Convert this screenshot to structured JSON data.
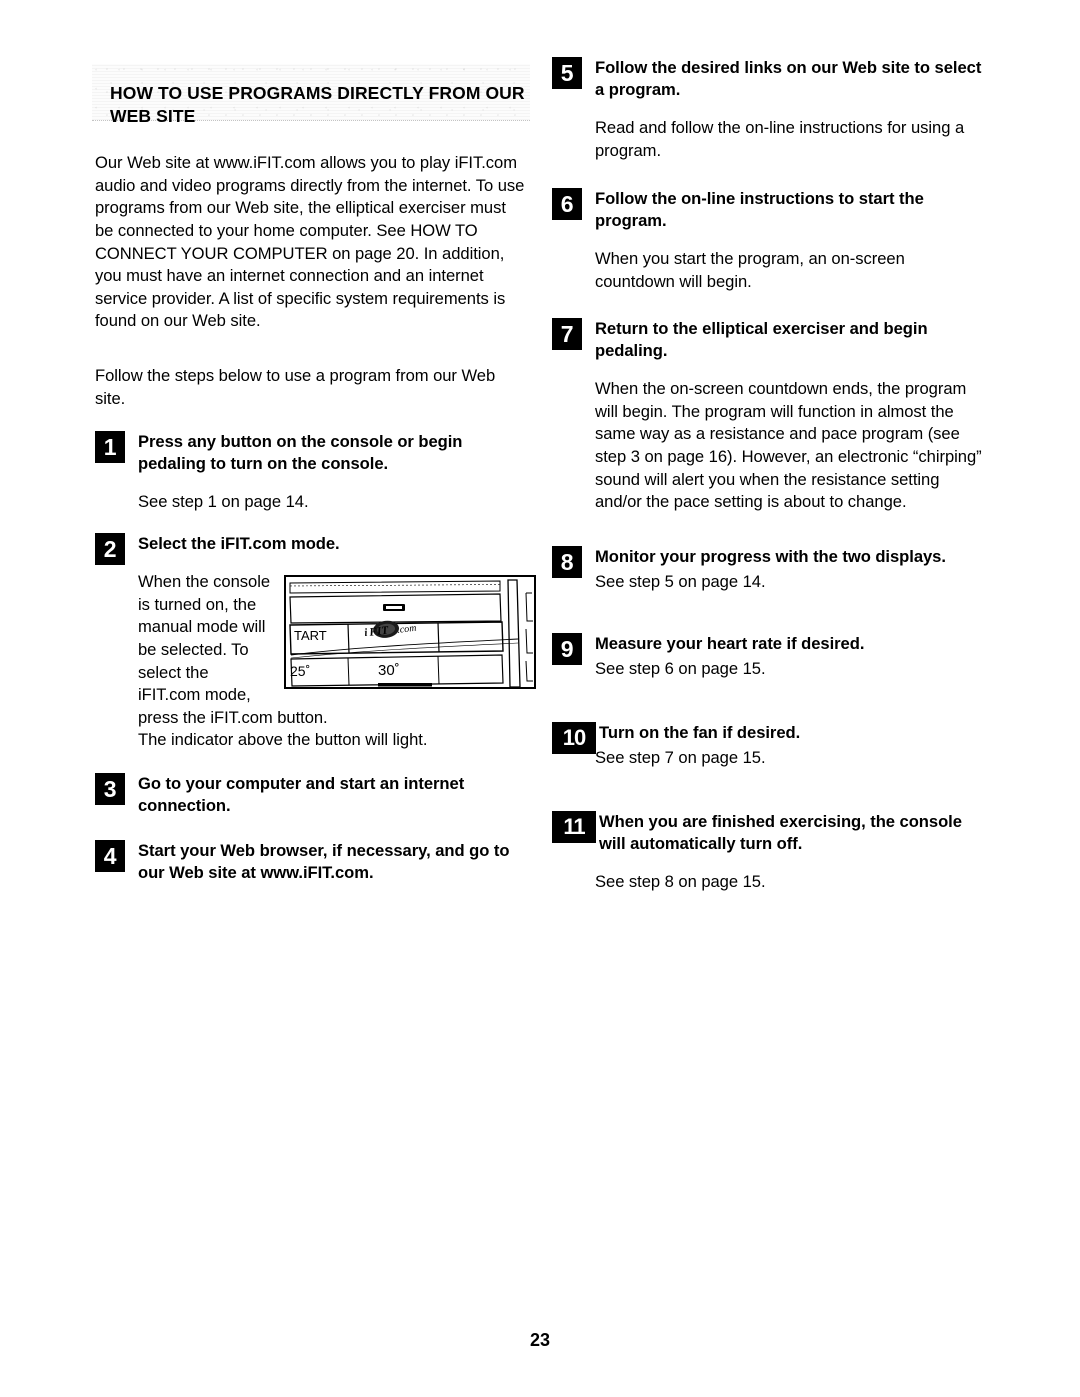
{
  "page": {
    "number": "23"
  },
  "section": {
    "heading": "HOW TO USE PROGRAMS DIRECTLY FROM OUR WEB SITE",
    "intro_paragraph": "Our Web site at www.iFIT.com allows you to play iFIT.com audio and video programs directly from the internet. To use programs from our Web site, the elliptical exerciser must be connected to your home computer. See HOW TO CONNECT YOUR COMPUTER on page 20. In addition, you must have an internet connection and an internet service provider. A list of specific system requirements is found on our Web site.",
    "follow_paragraph": "Follow the steps below to use a program from our Web site."
  },
  "steps": {
    "step1": {
      "number": "1",
      "title": "Press any button on the console or begin pedaling to turn on the console.",
      "body": "See step 1 on page 14."
    },
    "step2": {
      "number": "2",
      "title": "Select the iFIT.com mode.",
      "body_wrapped": "When the console is turned on, the manual mode will be selected. To select the iFIT.com mode, press the iFIT.com button.",
      "body_full": "The indicator above the button will light."
    },
    "step3": {
      "number": "3",
      "title": "Go to your computer and start an internet connection."
    },
    "step4": {
      "number": "4",
      "title": "Start your Web browser, if necessary, and go to our Web site at www.iFIT.com."
    },
    "step5": {
      "number": "5",
      "title": "Follow the desired links on our Web site to select a program.",
      "body": "Read and follow the on-line instructions for using a program."
    },
    "step6": {
      "number": "6",
      "title": "Follow the on-line instructions to start the program.",
      "body": "When you start the program, an on-screen countdown will begin."
    },
    "step7": {
      "number": "7",
      "title": "Return to the elliptical exerciser and begin pedaling.",
      "body": "When the on-screen countdown ends, the program will begin. The program will function in almost the same way as a resistance and pace program (see step 3 on page 16). However, an electronic “chirping” sound will alert you when the resistance setting and/or the pace setting is about to change."
    },
    "step8": {
      "number": "8",
      "title": "Monitor your progress with the two displays.",
      "body": "See step 5 on page 14."
    },
    "step9": {
      "number": "9",
      "title": "Measure your heart rate if desired.",
      "body": "See step 6 on page 15."
    },
    "step10": {
      "number": "10",
      "title": "Turn on the fan if desired.",
      "body": "See step 7 on page 15."
    },
    "step11": {
      "number": "11",
      "title": "When you are finished exercising, the console will automatically turn off.",
      "body": "See step 8 on page 15."
    }
  },
  "figure": {
    "label_start": "TART",
    "label_logo": "iFIT.com",
    "label_left_angle": "25˚",
    "label_right_angle": "30˚"
  }
}
